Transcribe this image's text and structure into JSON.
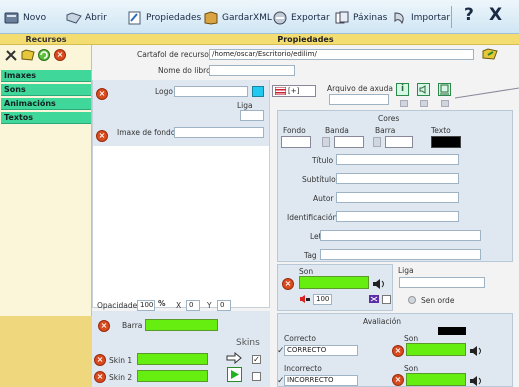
{
  "toolbar": {
    "novo": "Novo",
    "abrir": "Abrir",
    "propiedades": "Propiedades",
    "gardarxml": "GardarXML",
    "exportar": "Exportar",
    "paxinas": "Páxinas",
    "importar": "Importar",
    "help": "?",
    "close": "X"
  },
  "sidebar": {
    "title": "Recursos",
    "items": [
      {
        "label": "Imaxes"
      },
      {
        "label": "Sons"
      },
      {
        "label": "Animacións"
      },
      {
        "label": "Textos"
      }
    ]
  },
  "main": {
    "title": "Propiedades",
    "cartafol_label": "Cartafol de recursos",
    "cartafol_value": "/home/oscar/Escritorio/edilim/",
    "libro_label": "Nome do libro",
    "libro_value": "",
    "logo_label": "Logo",
    "liga_label": "Liga",
    "imaxe_fondo_label": "Imaxe de fondo",
    "opacidade_label": "Opacidade",
    "opacidade_value": "100",
    "opacidade_unit": "%",
    "x_label": "X",
    "x_value": "0",
    "y_label": "Y",
    "y_value": "0",
    "barra_label": "Barra",
    "skins_label": "Skins",
    "skin1_label": "Skin 1",
    "skin2_label": "Skin 2",
    "plus_button": "[+]",
    "arquivo_axuda_label": "Arquivo de axuda",
    "cores_label": "Cores",
    "fondo_label": "Fondo",
    "banda_label": "Banda",
    "barra_col_label": "Barra",
    "texto_label": "Texto",
    "titulo_label": "Título",
    "subtitulo_label": "Subtítulo",
    "autor_label": "Autor",
    "identificacion_label": "Identificación",
    "letras_label": "Letras",
    "tag_label": "Tag",
    "son_label": "Son",
    "liga2_label": "Liga",
    "volume_value": "100",
    "sen_orde_label": "Sen orde",
    "avaliacion_label": "Avaliación",
    "correcto_label": "Correcto",
    "correcto_value": "CORRECTO",
    "son_correcto_label": "Son",
    "incorrecto_label": "Incorrecto",
    "incorrecto_value": "INCORRECTO",
    "son_incorrecto_label": "Son"
  },
  "colors": {
    "accent_green": "#66ee11",
    "nav_green": "#3fd79a",
    "header_yellow": "#f3dd70",
    "delete_red": "#d94a1e"
  }
}
